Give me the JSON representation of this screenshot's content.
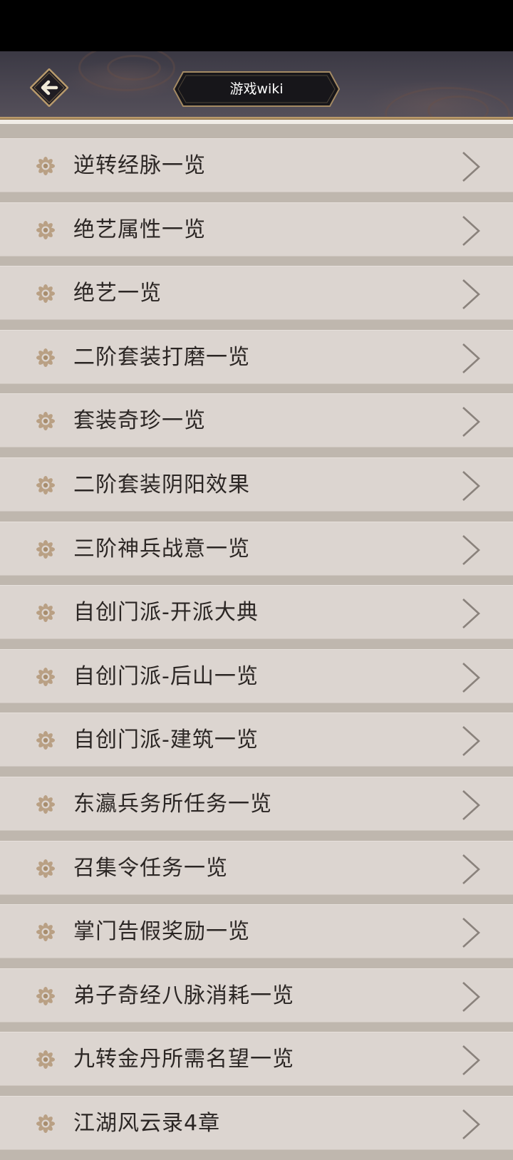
{
  "header": {
    "title": "游戏wiki",
    "back_icon": "arrow-left-icon"
  },
  "colors": {
    "header_bg": "#45414c",
    "gold_border": "#c9a977",
    "item_bg": "#dcd5d0",
    "page_bg": "#bfb7ae",
    "text": "#2b2624",
    "icon": "#b39a7e"
  },
  "list": {
    "item_icon": "flower-icon",
    "chevron_icon": "chevron-right-icon",
    "items": [
      {
        "label": "逆转经脉一览"
      },
      {
        "label": "绝艺属性一览"
      },
      {
        "label": "绝艺一览"
      },
      {
        "label": "二阶套装打磨一览"
      },
      {
        "label": "套装奇珍一览"
      },
      {
        "label": "二阶套装阴阳效果"
      },
      {
        "label": "三阶神兵战意一览"
      },
      {
        "label": "自创门派-开派大典"
      },
      {
        "label": "自创门派-后山一览"
      },
      {
        "label": "自创门派-建筑一览"
      },
      {
        "label": "东瀛兵务所任务一览"
      },
      {
        "label": "召集令任务一览"
      },
      {
        "label": "掌门告假奖励一览"
      },
      {
        "label": "弟子奇经八脉消耗一览"
      },
      {
        "label": "九转金丹所需名望一览"
      },
      {
        "label": "江湖风云录4章"
      }
    ]
  }
}
